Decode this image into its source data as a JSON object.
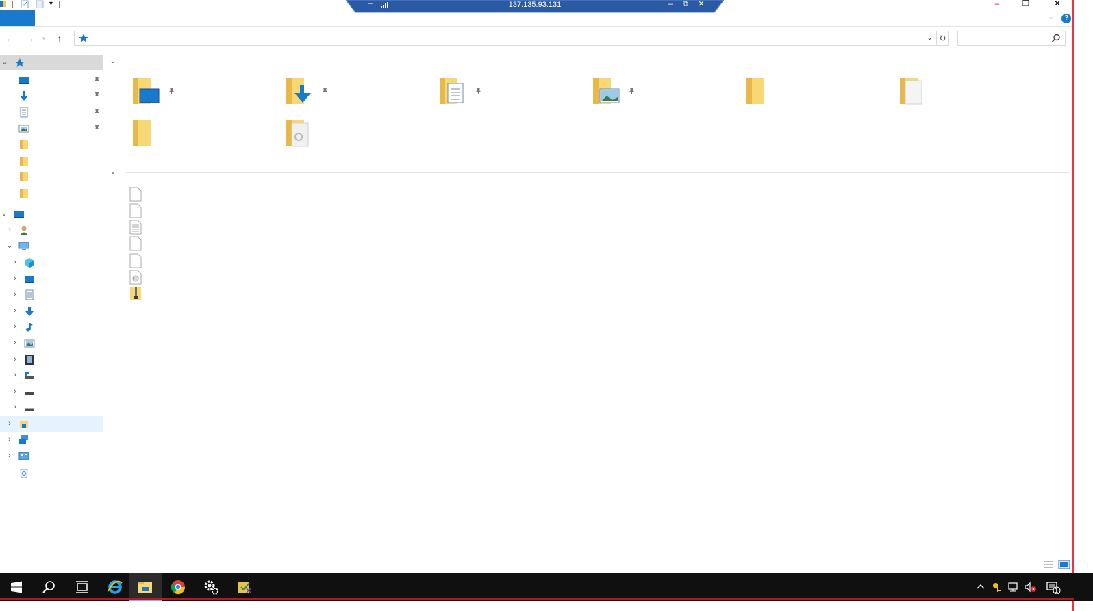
{
  "rdp_bar": {
    "host": "137.135.93.131"
  },
  "explorer": {
    "address": {
      "value": ""
    },
    "search": {
      "placeholder": ""
    },
    "help_label": "?"
  },
  "navigation": {
    "quick_access": [
      "desktop-icon",
      "downloads-icon",
      "documents-icon",
      "pictures-icon",
      "folder-icon",
      "folder-icon",
      "folder-icon",
      "folder-icon"
    ],
    "this_pc_children": [
      "3d-objects-icon",
      "desktop-icon",
      "documents-icon",
      "downloads-icon",
      "music-icon",
      "pictures-icon",
      "videos-icon",
      "os-drive-icon",
      "drive-icon",
      "drive-icon"
    ],
    "bottom_items": [
      "libraries-icon",
      "network-icon",
      "control-panel-icon",
      "recycle-bin-icon"
    ]
  },
  "content": {
    "frequent_folders": [
      "desktop",
      "downloads",
      "documents",
      "pictures",
      "folder",
      "folder-doc",
      "folder",
      "folder-settings"
    ],
    "recent_files": [
      "blank-file",
      "blank-file",
      "text-file",
      "blank-file",
      "blank-file",
      "settings-file",
      "zip-folder"
    ]
  },
  "taskbar": {
    "apps": [
      "start-icon",
      "search-icon",
      "task-view-icon",
      "internet-explorer-icon",
      "file-explorer-icon",
      "chrome-icon",
      "settings-icon",
      "remote-tool-icon"
    ],
    "notification_count": "1"
  },
  "colors": {
    "accent": "#1979ca",
    "taskbar": "#101010",
    "selection": "#d9d9d9",
    "hover": "#e5f3ff",
    "rdp_bar": "#2b5aa5"
  }
}
